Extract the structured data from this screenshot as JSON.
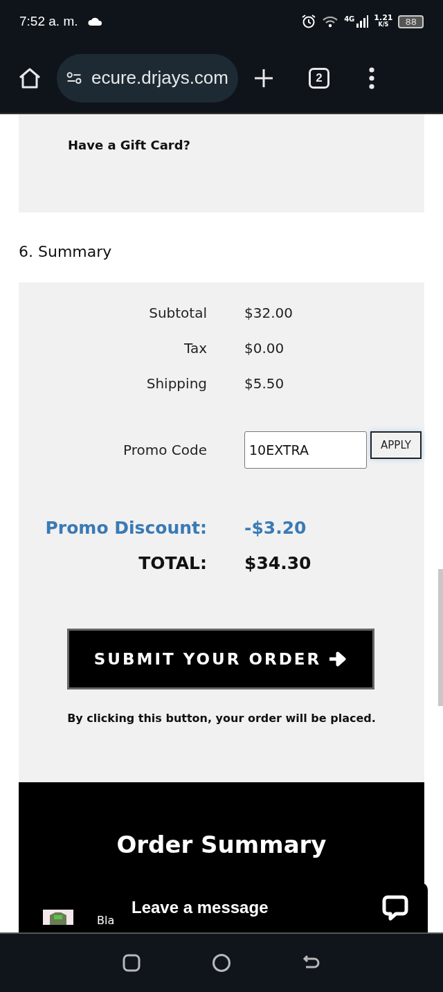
{
  "status_bar": {
    "time": "7:52 a. m.",
    "network": "4G",
    "speed": "1.21",
    "speed_unit": "K/S",
    "battery": "88"
  },
  "browser": {
    "url": "ecure.drjays.com",
    "tab_count": "2"
  },
  "gift_card": {
    "title": "Have a Gift Card?"
  },
  "summary": {
    "heading": "6. Summary",
    "rows": [
      {
        "label": "Subtotal",
        "value": "$32.00"
      },
      {
        "label": "Tax",
        "value": "$0.00"
      },
      {
        "label": "Shipping",
        "value": "$5.50"
      }
    ],
    "promo": {
      "label": "Promo Code",
      "value": "10EXTRA",
      "button": "APPLY"
    },
    "discount": {
      "label": "Promo Discount:",
      "value": "-$3.20"
    },
    "total": {
      "label": "TOTAL:",
      "value": "$34.30"
    },
    "submit": "SUBMIT YOUR ORDER",
    "note": "By clicking this button, your order will be placed."
  },
  "order_summary": {
    "title": "Order Summary",
    "first_item": "Bla"
  },
  "chat": {
    "label": "Leave a message"
  }
}
